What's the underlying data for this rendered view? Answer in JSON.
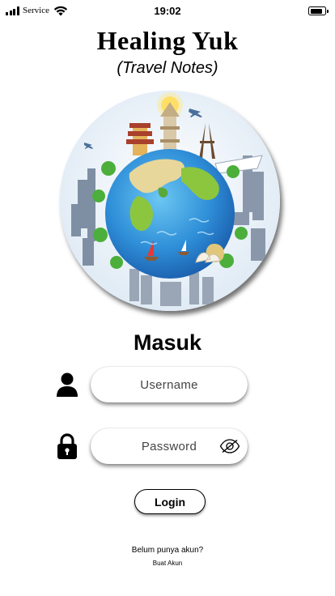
{
  "status_bar": {
    "carrier": "Service",
    "time": "19:02"
  },
  "header": {
    "title": "Healing Yuk",
    "subtitle": "(Travel Notes)"
  },
  "hero": {
    "image": "travel-globe-illustration"
  },
  "form": {
    "heading": "Masuk",
    "username_placeholder": "Username",
    "password_placeholder": "Password",
    "login_label": "Login"
  },
  "footer": {
    "signup_prompt": "Belum punya akun?",
    "signup_link": "Buat Akun"
  },
  "colors": {
    "ocean": "#2f8fd8",
    "land": "#8cc63f",
    "text": "#000000"
  }
}
